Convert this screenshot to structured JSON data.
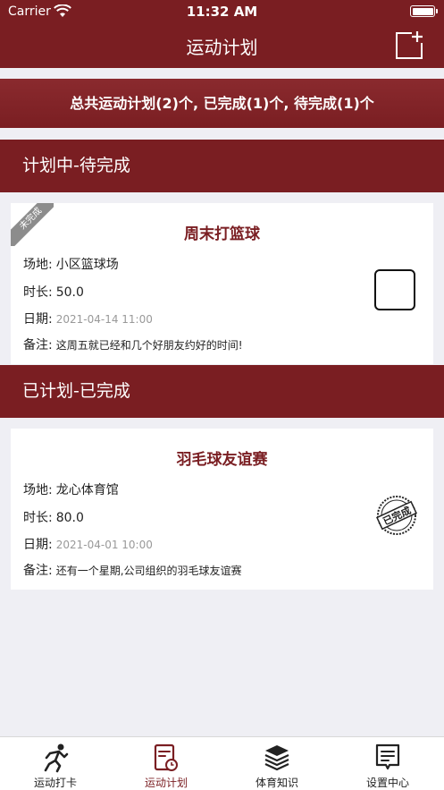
{
  "status_bar": {
    "carrier": "Carrier",
    "time": "11:32 AM"
  },
  "nav": {
    "title": "运动计划",
    "add_icon": "add-note-icon"
  },
  "summary": {
    "text": "总共运动计划(2)个, 已完成(1)个, 待完成(1)个"
  },
  "sections": {
    "pending": {
      "title": "计划中-待完成",
      "card": {
        "ribbon": "未完成",
        "name": "周末打篮球",
        "venue_label": "场地:",
        "venue": "小区篮球场",
        "duration_label": "时长:",
        "duration": "50.0",
        "date_label": "日期:",
        "date": "2021-04-14 11:00",
        "note_label": "备注:",
        "note": "这周五就已经和几个好朋友约好的时间!"
      }
    },
    "done": {
      "title": "已计划-已完成",
      "card": {
        "name": "羽毛球友谊赛",
        "venue_label": "场地:",
        "venue": "龙心体育馆",
        "duration_label": "时长:",
        "duration": "80.0",
        "date_label": "日期:",
        "date": "2021-04-01 10:00",
        "note_label": "备注:",
        "note": "还有一个星期,公司组织的羽毛球友谊赛",
        "stamp": "已完成"
      }
    }
  },
  "tabs": [
    {
      "label": "运动打卡",
      "icon": "runner-icon",
      "active": false
    },
    {
      "label": "运动计划",
      "icon": "plan-calendar-icon",
      "active": true
    },
    {
      "label": "体育知识",
      "icon": "books-icon",
      "active": false
    },
    {
      "label": "设置中心",
      "icon": "settings-doc-icon",
      "active": false
    }
  ],
  "colors": {
    "primary": "#7a1e22",
    "background": "#efeff4",
    "muted": "#999999"
  }
}
